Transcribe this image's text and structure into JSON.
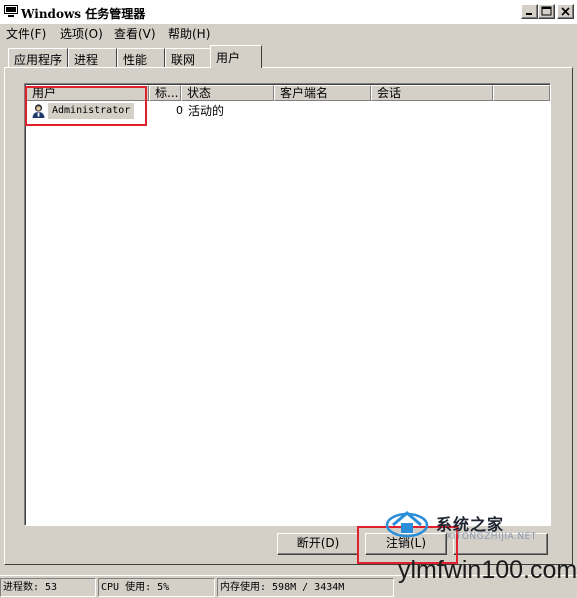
{
  "window": {
    "title": "Windows 任务管理器",
    "controls": [
      "minimize-icon",
      "maximize-icon",
      "close-icon"
    ]
  },
  "menu": {
    "items": [
      {
        "label": "文件(F)"
      },
      {
        "label": "选项(O)"
      },
      {
        "label": "查看(V)"
      },
      {
        "label": "帮助(H)"
      }
    ]
  },
  "tabs": [
    {
      "label": "应用程序",
      "active": false
    },
    {
      "label": "进程",
      "active": false
    },
    {
      "label": "性能",
      "active": false
    },
    {
      "label": "联网",
      "active": false
    },
    {
      "label": "用户",
      "active": true
    }
  ],
  "users_table": {
    "columns": [
      "用户",
      "标...",
      "状态",
      "客户端名",
      "会话"
    ],
    "rows": [
      {
        "user": "Administrator",
        "id": "0",
        "status": "活动的",
        "client": "",
        "session": "",
        "selected": true,
        "icon": "user-icon"
      }
    ]
  },
  "actions": {
    "disconnect": "断开(D)",
    "logoff": "注销(L)"
  },
  "statusbar": {
    "processes": "进程数: 53",
    "cpu": "CPU 使用: 5%",
    "memory": "内存使用: 598M / 3434M"
  },
  "watermark": {
    "brand": "系统之家",
    "sub": "XITONGZHIJIA.NET",
    "site": "ylmfwin100.com"
  },
  "annotation_color": "#e0202c"
}
